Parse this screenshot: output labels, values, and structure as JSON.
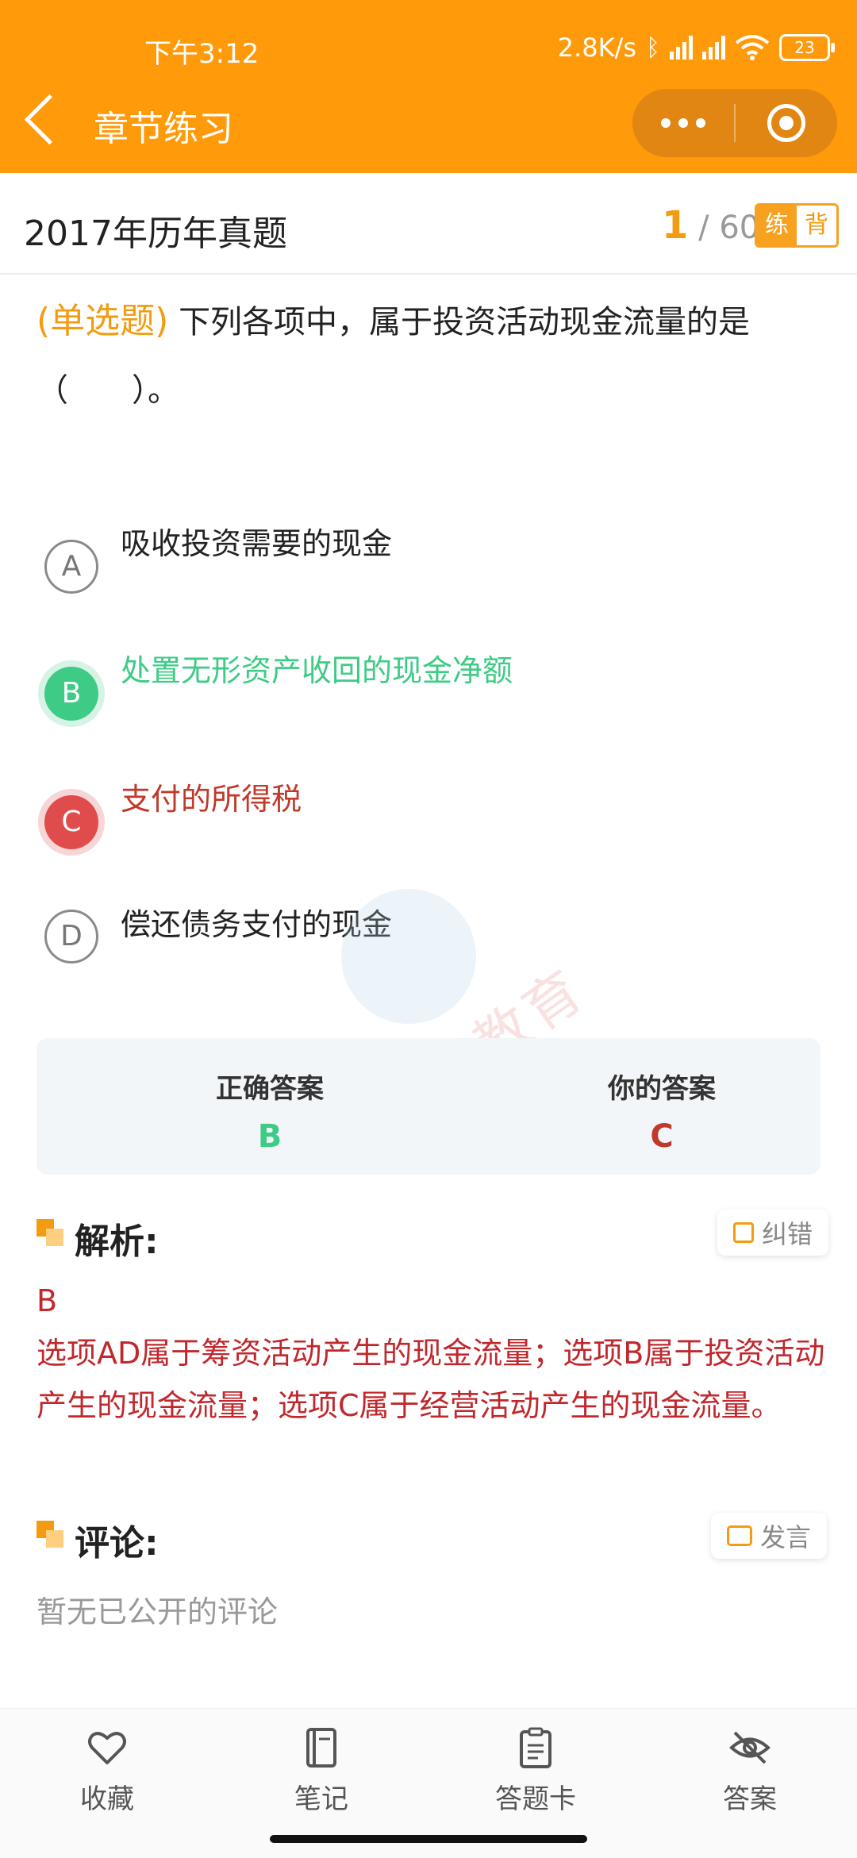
{
  "status_bar": {
    "time": "下午3:12",
    "network_speed": "2.8K/s",
    "battery": "23"
  },
  "header": {
    "title": "章节练习"
  },
  "subheader": {
    "title": "2017年历年真题",
    "current": "1",
    "total_sep": "/ 60",
    "mode_practice": "练",
    "mode_recite": "背"
  },
  "question": {
    "type": "(单选题)",
    "text": "下列各项中，属于投资活动现金流量的是（　　）。"
  },
  "options": [
    {
      "letter": "A",
      "text": "吸收投资需要的现金",
      "state": "normal"
    },
    {
      "letter": "B",
      "text": "处置无形资产收回的现金净额",
      "state": "correct"
    },
    {
      "letter": "C",
      "text": "支付的所得税",
      "state": "wrong"
    },
    {
      "letter": "D",
      "text": "偿还债务支付的现金",
      "state": "normal"
    }
  ],
  "watermark": "朗初教育",
  "answer": {
    "correct_label": "正确答案",
    "correct_value": "B",
    "yours_label": "你的答案",
    "yours_value": "C"
  },
  "analysis": {
    "title": "解析:",
    "report_label": "纠错",
    "answer_line": "B",
    "body": "选项AD属于筹资活动产生的现金流量；选项B属于投资活动产生的现金流量；选项C属于经营活动产生的现金流量。"
  },
  "comments": {
    "title": "评论:",
    "post_label": "发言",
    "empty_text": "暂无已公开的评论"
  },
  "bottom_tabs": {
    "favorite": "收藏",
    "notes": "笔记",
    "answer_card": "答题卡",
    "answer": "答案"
  },
  "colors": {
    "brand": "#FF9A0B",
    "correct": "#3DCB86",
    "wrong": "#E04B4B",
    "analysis_text": "#C0282D"
  }
}
